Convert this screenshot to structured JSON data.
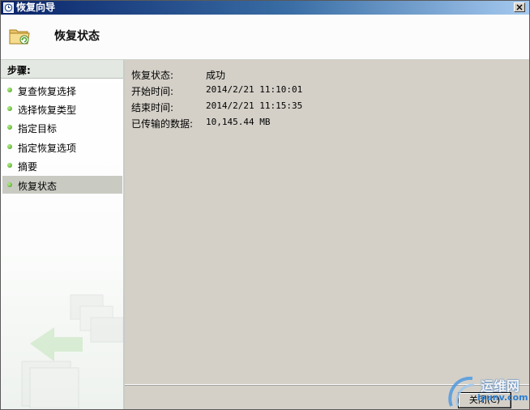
{
  "window": {
    "title": "恢复向导",
    "close_icon": "close-x-icon"
  },
  "header": {
    "title": "恢复状态",
    "icon": "folder-restore-icon"
  },
  "sidebar": {
    "header": "步骤:",
    "items": [
      {
        "label": "复查恢复选择",
        "active": false
      },
      {
        "label": "选择恢复类型",
        "active": false
      },
      {
        "label": "指定目标",
        "active": false
      },
      {
        "label": "指定恢复选项",
        "active": false
      },
      {
        "label": "摘要",
        "active": false
      },
      {
        "label": "恢复状态",
        "active": true
      }
    ]
  },
  "status": {
    "rows": [
      {
        "label": "恢复状态:",
        "value": "成功"
      },
      {
        "label": "开始时间:",
        "value": "2014/2/21 11:10:01"
      },
      {
        "label": "结束时间:",
        "value": "2014/2/21 11:15:35"
      },
      {
        "label": "已传输的数据:",
        "value": "10,145.44 MB"
      }
    ]
  },
  "footer": {
    "close_label": "关闭(C)"
  },
  "watermark": {
    "text": "运维网",
    "sub": "iyunv.com"
  },
  "colors": {
    "title_start": "#0a246a",
    "title_end": "#a6caf0",
    "active_step": "#c9cbc3",
    "panel": "#d4d0c8",
    "step_dot": "#3c9a12"
  }
}
